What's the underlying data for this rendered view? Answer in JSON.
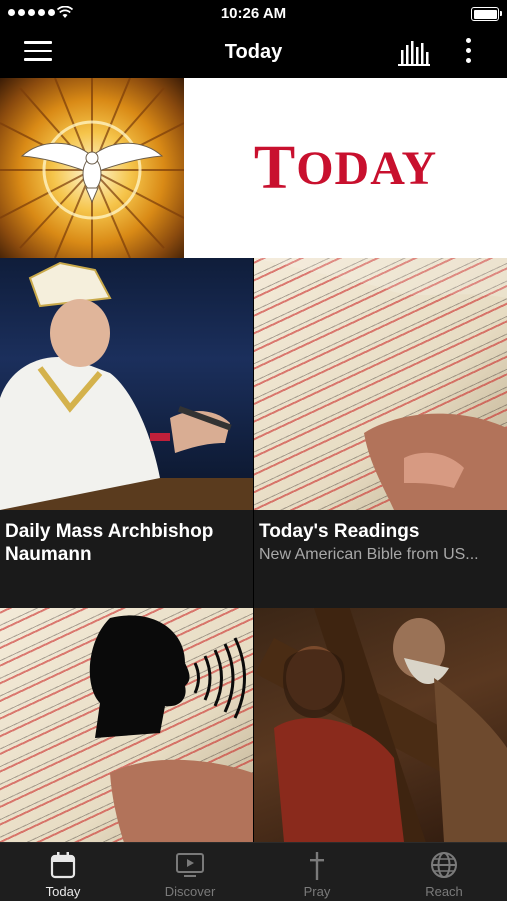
{
  "status_bar": {
    "time": "10:26 AM"
  },
  "nav": {
    "title": "Today"
  },
  "banner": {
    "word_first": "T",
    "word_rest": "ODAY"
  },
  "tiles": [
    {
      "title": "Daily Mass Archbishop Naumann",
      "subtitle": ""
    },
    {
      "title": "Today's Readings",
      "subtitle": "New American Bible from US..."
    },
    {
      "title": "",
      "subtitle": ""
    },
    {
      "title": "",
      "subtitle": ""
    }
  ],
  "tabs": [
    {
      "label": "Today",
      "icon": "calendar-icon",
      "active": true
    },
    {
      "label": "Discover",
      "icon": "tv-play-icon",
      "active": false
    },
    {
      "label": "Pray",
      "icon": "cross-icon",
      "active": false
    },
    {
      "label": "Reach",
      "icon": "globe-icon",
      "active": false
    }
  ],
  "colors": {
    "brand_red": "#c8102e",
    "tab_bar": "#1e1e1e",
    "background": "#000000"
  }
}
